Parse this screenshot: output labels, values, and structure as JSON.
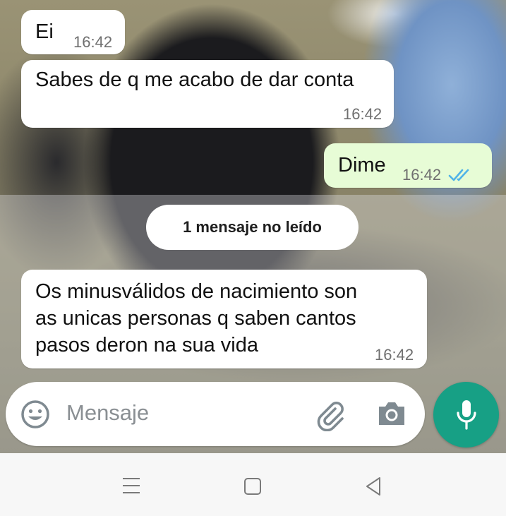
{
  "messages": [
    {
      "direction": "incoming",
      "text": "Ei",
      "time": "16:42"
    },
    {
      "direction": "incoming",
      "text": "Sabes de q me acabo de dar conta",
      "time": "16:42"
    },
    {
      "direction": "outgoing",
      "text": "Dime",
      "time": "16:42",
      "status": "read"
    },
    {
      "direction": "incoming",
      "text": "Os minusválidos de nacimiento son\nas unicas personas q saben cantos\npasos deron na sua vida",
      "time": "16:42"
    }
  ],
  "unread_divider": "1 mensaje no leído",
  "composer": {
    "placeholder": "Mensaje",
    "emoji_icon": "emoji-icon",
    "attach_icon": "paperclip-icon",
    "camera_icon": "camera-icon",
    "mic_icon": "microphone-icon"
  },
  "navbar": {
    "recents_icon": "menu-lines-icon",
    "home_icon": "home-square-icon",
    "back_icon": "back-triangle-icon"
  },
  "colors": {
    "incoming_bubble": "#ffffff",
    "outgoing_bubble": "#e7fcd6",
    "mic_button": "#17a085",
    "read_ticks": "#4fb3e8"
  }
}
